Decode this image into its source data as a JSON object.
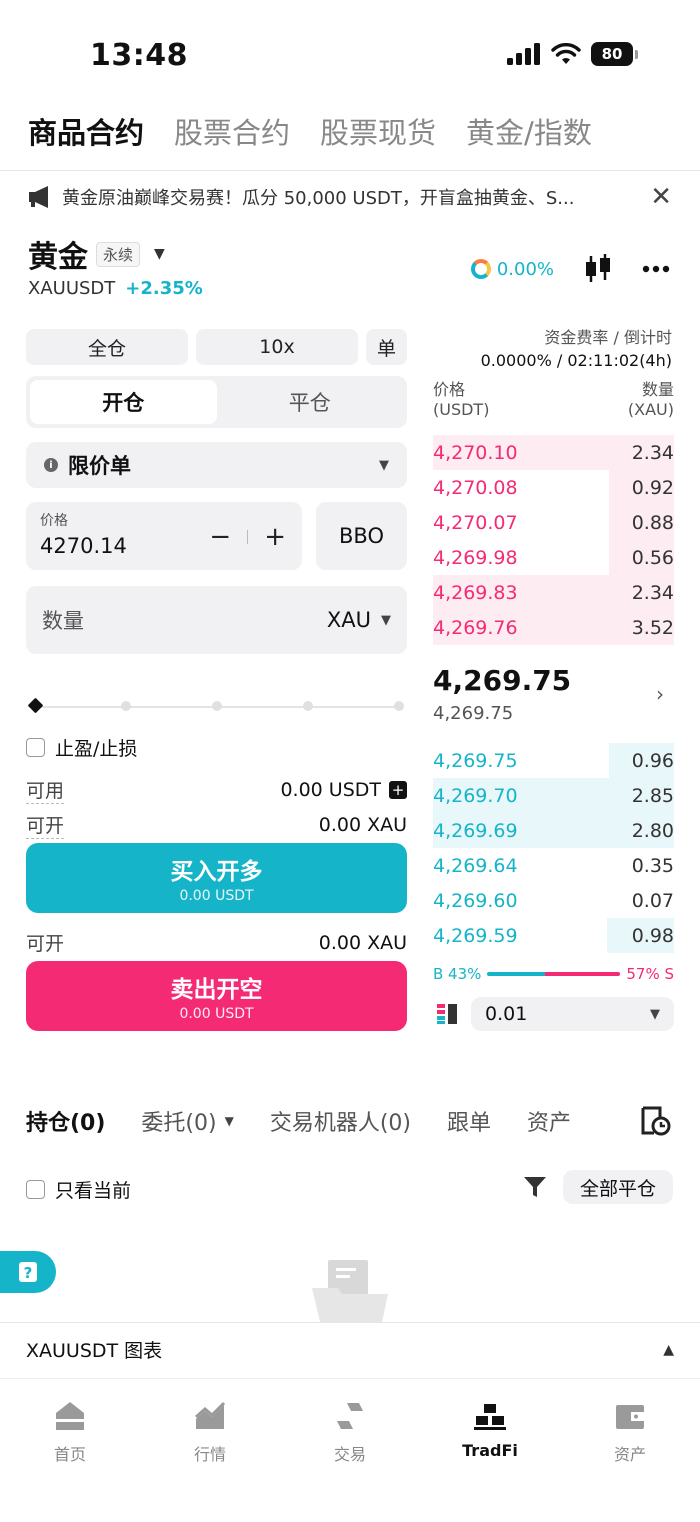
{
  "status": {
    "time": "13:48",
    "battery": "80"
  },
  "tabs": [
    "商品合约",
    "股票合约",
    "股票现货",
    "黄金/指数"
  ],
  "notice": {
    "text": "黄金原油巅峰交易赛！瓜分 50,000 USDT，开盲盒抽黄金、S..."
  },
  "header": {
    "name": "黄金",
    "badge": "永续",
    "pair": "XAUUSDT",
    "change": "+2.35%",
    "funding_pct": "0.00%"
  },
  "controls": {
    "margin_mode": "全仓",
    "leverage": "10x",
    "position_mode": "单"
  },
  "segment": {
    "open": "开仓",
    "close": "平仓"
  },
  "order": {
    "type": "限价单",
    "price_label": "价格",
    "price_value": "4270.14",
    "minus": "−",
    "plus": "+",
    "bbo": "BBO",
    "qty_placeholder": "数量",
    "qty_unit": "XAU"
  },
  "tpsl_label": "止盈/止损",
  "avail": {
    "label": "可用",
    "value": "0.00 USDT"
  },
  "can_open_long": {
    "label": "可开",
    "value": "0.00 XAU"
  },
  "buy": {
    "title": "买入开多",
    "sub": "0.00 USDT"
  },
  "can_open_short": {
    "label": "可开",
    "value": "0.00 XAU"
  },
  "sell": {
    "title": "卖出开空",
    "sub": "0.00 USDT"
  },
  "funding": {
    "label": "资金费率 / 倒计时",
    "value": "0.0000% / 02:11:02(4h)"
  },
  "orderbook": {
    "price_header": "价格",
    "price_unit": "(USDT)",
    "qty_header": "数量",
    "qty_unit": "(XAU)",
    "asks": [
      {
        "price": "4,270.10",
        "qty": "2.34",
        "depth": 1.0
      },
      {
        "price": "4,270.08",
        "qty": "0.92",
        "depth": 0.27
      },
      {
        "price": "4,270.07",
        "qty": "0.88",
        "depth": 0.27
      },
      {
        "price": "4,269.98",
        "qty": "0.56",
        "depth": 0.27
      },
      {
        "price": "4,269.83",
        "qty": "2.34",
        "depth": 1.0
      },
      {
        "price": "4,269.76",
        "qty": "3.52",
        "depth": 1.0
      }
    ],
    "last_price": "4,269.75",
    "mark_price": "4,269.75",
    "bids": [
      {
        "price": "4,269.75",
        "qty": "0.96",
        "depth": 0.27
      },
      {
        "price": "4,269.70",
        "qty": "2.85",
        "depth": 1.0
      },
      {
        "price": "4,269.69",
        "qty": "2.80",
        "depth": 1.0
      },
      {
        "price": "4,269.64",
        "qty": "0.35",
        "depth": 0.0
      },
      {
        "price": "4,269.60",
        "qty": "0.07",
        "depth": 0.0
      },
      {
        "price": "4,269.59",
        "qty": "0.98",
        "depth": 0.28
      }
    ],
    "buy_ratio": "B 43%",
    "sell_ratio": "57% S",
    "buy_fraction": 0.43,
    "depth_value": "0.01"
  },
  "position_tabs": [
    "持仓(0)",
    "委托(0)",
    "交易机器人(0)",
    "跟单",
    "资产"
  ],
  "only_current": "只看当前",
  "close_all": "全部平仓",
  "chart_bar": "XAUUSDT 图表",
  "nav": [
    "首页",
    "行情",
    "交易",
    "TradFi",
    "资产"
  ],
  "colors": {
    "accent": "#16b4c8",
    "sell": "#f52a75"
  }
}
